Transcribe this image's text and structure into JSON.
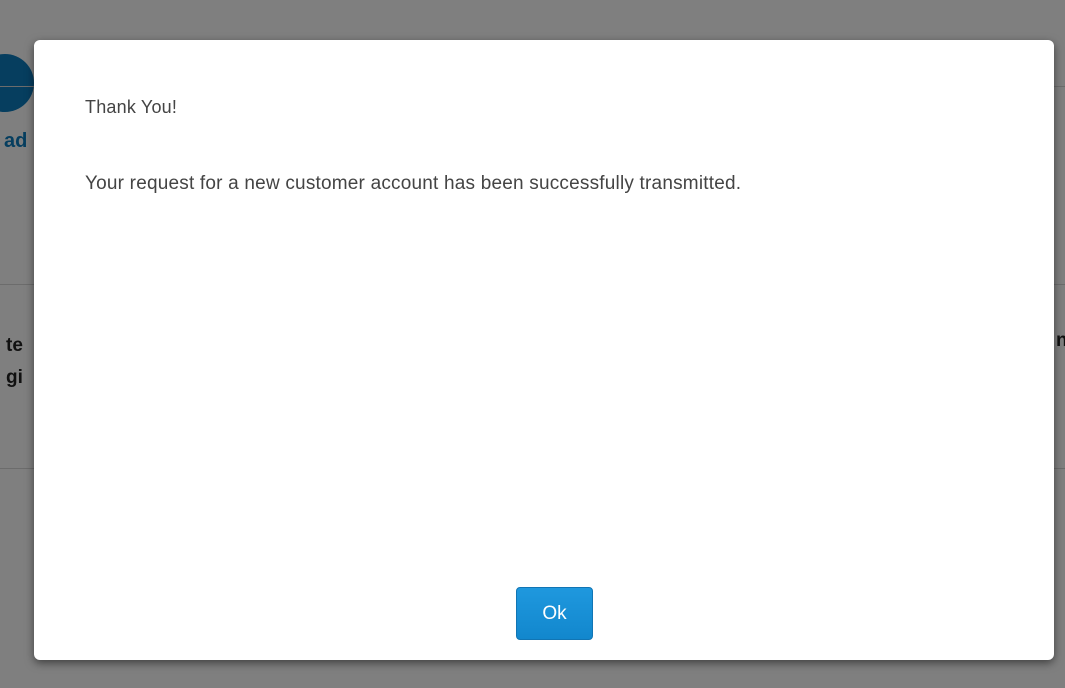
{
  "background": {
    "fragment_top": "ad",
    "fragment_mid_1": "te",
    "fragment_mid_2": "gi",
    "fragment_right": "n"
  },
  "dialog": {
    "title": "Thank You!",
    "message": "Your request for a new customer account has been successfully transmitted.",
    "ok_label": "Ok"
  },
  "colors": {
    "accent": "#1287cd",
    "overlay": "rgba(0,0,0,0.5)",
    "text": "#444444"
  }
}
